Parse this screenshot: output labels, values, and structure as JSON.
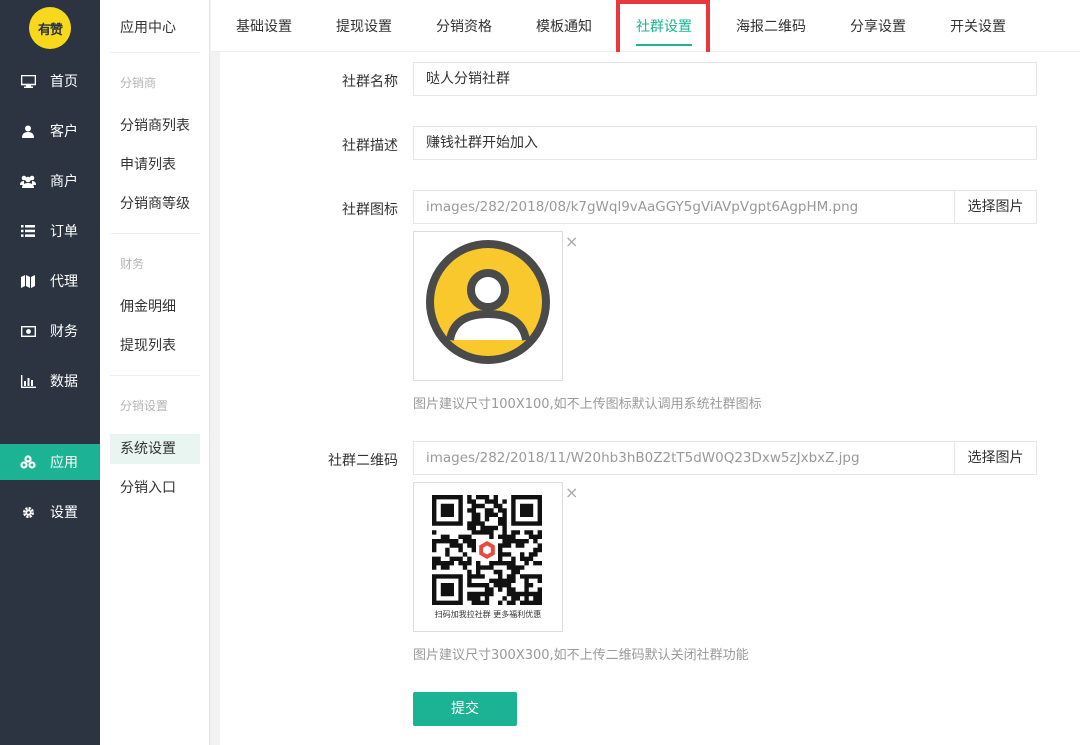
{
  "logo_text": "有赞",
  "nav": [
    {
      "label": "首页",
      "icon": "monitor-icon"
    },
    {
      "label": "客户",
      "icon": "user-icon"
    },
    {
      "label": "商户",
      "icon": "users-icon"
    },
    {
      "label": "订单",
      "icon": "list-icon"
    },
    {
      "label": "代理",
      "icon": "map-icon"
    },
    {
      "label": "财务",
      "icon": "money-icon"
    },
    {
      "label": "数据",
      "icon": "bar-chart-icon"
    },
    {
      "label": "应用",
      "icon": "apps-icon",
      "active": true
    },
    {
      "label": "设置",
      "icon": "gear-icon"
    }
  ],
  "subnav": {
    "title": "应用中心",
    "group1": "分销商",
    "items1": [
      "分销商列表",
      "申请列表",
      "分销商等级"
    ],
    "group2": "财务",
    "items2": [
      "佣金明细",
      "提现列表"
    ],
    "group3": "分销设置",
    "items3": [
      "系统设置",
      "分销入口"
    ]
  },
  "tabs": [
    "基础设置",
    "提现设置",
    "分销资格",
    "模板通知",
    "社群设置",
    "海报二维码",
    "分享设置",
    "开关设置"
  ],
  "active_tab": "社群设置",
  "form": {
    "name_label": "社群名称",
    "name_value": "哒人分销社群",
    "desc_label": "社群描述",
    "desc_value": "赚钱社群开始加入",
    "icon_label": "社群图标",
    "icon_path": "images/282/2018/08/k7gWql9vAaGGY5gViAVpVgpt6AgpHM.png",
    "icon_pick": "选择图片",
    "icon_hint": "图片建议尺寸100X100,如不上传图标默认调用系统社群图标",
    "qr_label": "社群二维码",
    "qr_path": "images/282/2018/11/W20hb3hB0Z2tT5dW0Q23Dxw5zJxbxZ.jpg",
    "qr_pick": "选择图片",
    "qr_caption": "扫码加我拉社群 更多福利优惠",
    "qr_hint": "图片建议尺寸300X300,如不上传二维码默认关闭社群功能",
    "submit": "提交",
    "remove_glyph": "×"
  },
  "colors": {
    "accent": "#1cb394",
    "sidebar": "#2b3440",
    "highlight": "#e8383d",
    "logo": "#f8d81c"
  }
}
